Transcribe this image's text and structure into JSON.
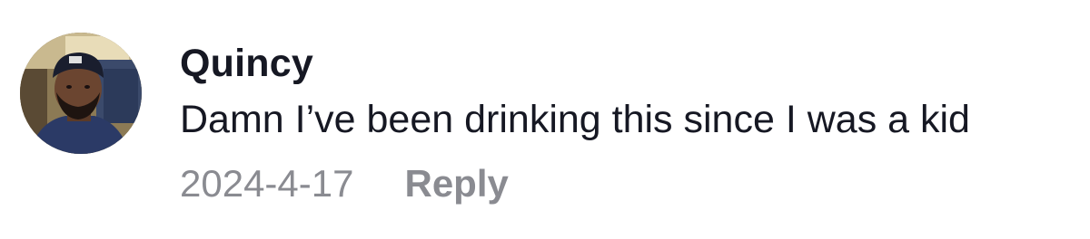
{
  "comment": {
    "username": "Quincy",
    "text": "Damn I’ve been drinking this since I was a kid",
    "date": "2024-4-17",
    "reply_label": "Reply"
  }
}
